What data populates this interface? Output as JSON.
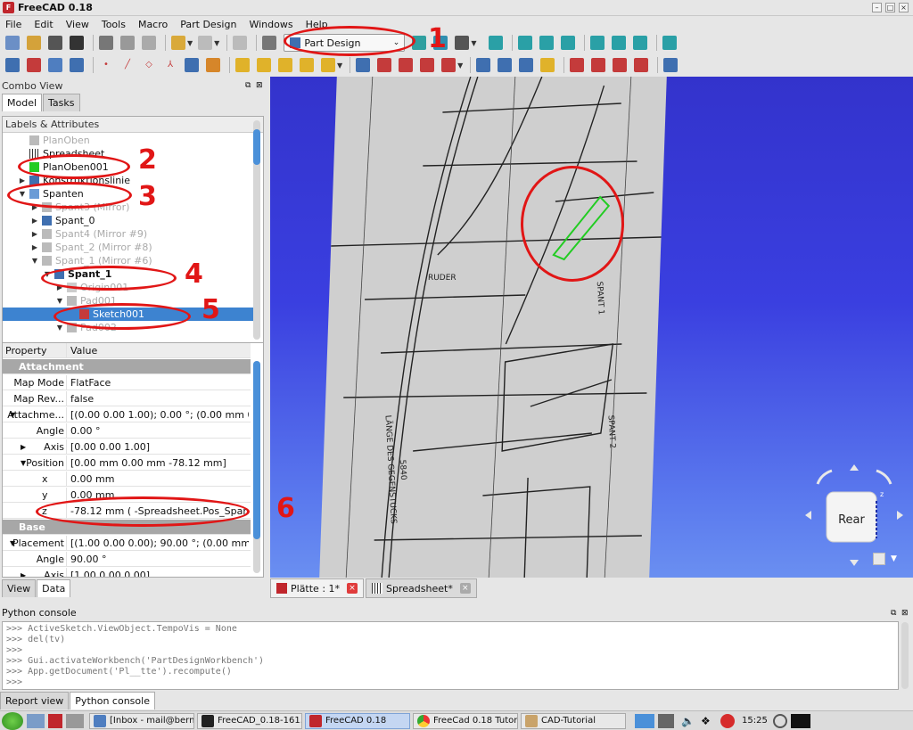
{
  "window": {
    "title": "FreeCAD 0.18"
  },
  "menu": [
    "File",
    "Edit",
    "View",
    "Tools",
    "Macro",
    "Part Design",
    "Windows",
    "Help"
  ],
  "workbench": {
    "selected": "Part Design"
  },
  "combo_view": {
    "title": "Combo View",
    "tabs": [
      "Model",
      "Tasks"
    ],
    "tree_header": "Labels & Attributes",
    "tree_items": [
      {
        "label": "PlanOben"
      },
      {
        "label": "Spreadsheet"
      },
      {
        "label": "PlanOben001"
      },
      {
        "label": "Konstruktionslinie"
      },
      {
        "label": "Spanten"
      },
      {
        "label": "Spant3 (Mirror)"
      },
      {
        "label": "Spant_0"
      },
      {
        "label": "Spant4 (Mirror #9)"
      },
      {
        "label": "Spant_2 (Mirror #8)"
      },
      {
        "label": "Spant_1 (Mirror #6)"
      },
      {
        "label": "Spant_1"
      },
      {
        "label": "Origin001"
      },
      {
        "label": "Pad001"
      },
      {
        "label": "Sketch001"
      },
      {
        "label": "Pad002"
      }
    ]
  },
  "properties": {
    "col_property": "Property",
    "col_value": "Value",
    "rows": [
      {
        "name": "Attachment",
        "value": ""
      },
      {
        "name": "Map Mode",
        "value": "FlatFace"
      },
      {
        "name": "Map Rev...",
        "value": "false"
      },
      {
        "name": "Attachme...",
        "value": "[(0.00 0.00 1.00); 0.00 °; (0.00 mm  0.00 ..."
      },
      {
        "name": "Angle",
        "value": "0.00 °"
      },
      {
        "name": "Axis",
        "value": "[0.00 0.00 1.00]"
      },
      {
        "name": "Position",
        "value": "[0.00 mm  0.00 mm  -78.12 mm]"
      },
      {
        "name": "x",
        "value": "0.00 mm"
      },
      {
        "name": "y",
        "value": "0.00 mm"
      },
      {
        "name": "z",
        "value": "-78.12 mm  ( -Spreadsheet.Pos_Spant1 )"
      },
      {
        "name": "Base",
        "value": ""
      },
      {
        "name": "Placement",
        "value": "[(1.00 0.00 0.00); 90.00 °; (0.00 mm  78...."
      },
      {
        "name": "Angle",
        "value": "90.00 °"
      },
      {
        "name": "Axis",
        "value": "[1.00 0.00 0.00]"
      }
    ],
    "tabs": [
      "View",
      "Data"
    ]
  },
  "viewport": {
    "navcube_label": "Rear",
    "navcube_axis_label": "z",
    "drawing_labels": [
      "SPANT 1",
      "SPANT 2",
      "LÄNGE DES GEGENSTUCKS",
      "5840",
      "RUDER"
    ]
  },
  "document_tabs": [
    {
      "label": "Plätte : 1*"
    },
    {
      "label": "Spreadsheet*"
    }
  ],
  "python_console": {
    "title": "Python console",
    "lines": [
      ">>> ActiveSketch.ViewObject.TempoVis = None",
      ">>> del(tv)",
      ">>>",
      ">>> Gui.activateWorkbench('PartDesignWorkbench')",
      ">>> App.getDocument('Pl__tte').recompute()",
      ">>>"
    ]
  },
  "bottom_tabs": [
    "Report view",
    "Python console"
  ],
  "annotations": [
    "1",
    "2",
    "3",
    "4",
    "5",
    "6"
  ],
  "taskbar": {
    "items": [
      "[Inbox - mail@bern...",
      "FreeCAD_0.18-161...",
      "FreeCAD 0.18",
      "FreeCad 0.18 Tutor...",
      "CAD-Tutorial"
    ],
    "clock": "15:25"
  },
  "colors": {
    "selection": "#3d83d0",
    "viewport_bg": "#3333cc",
    "annotation": "#e11616"
  }
}
